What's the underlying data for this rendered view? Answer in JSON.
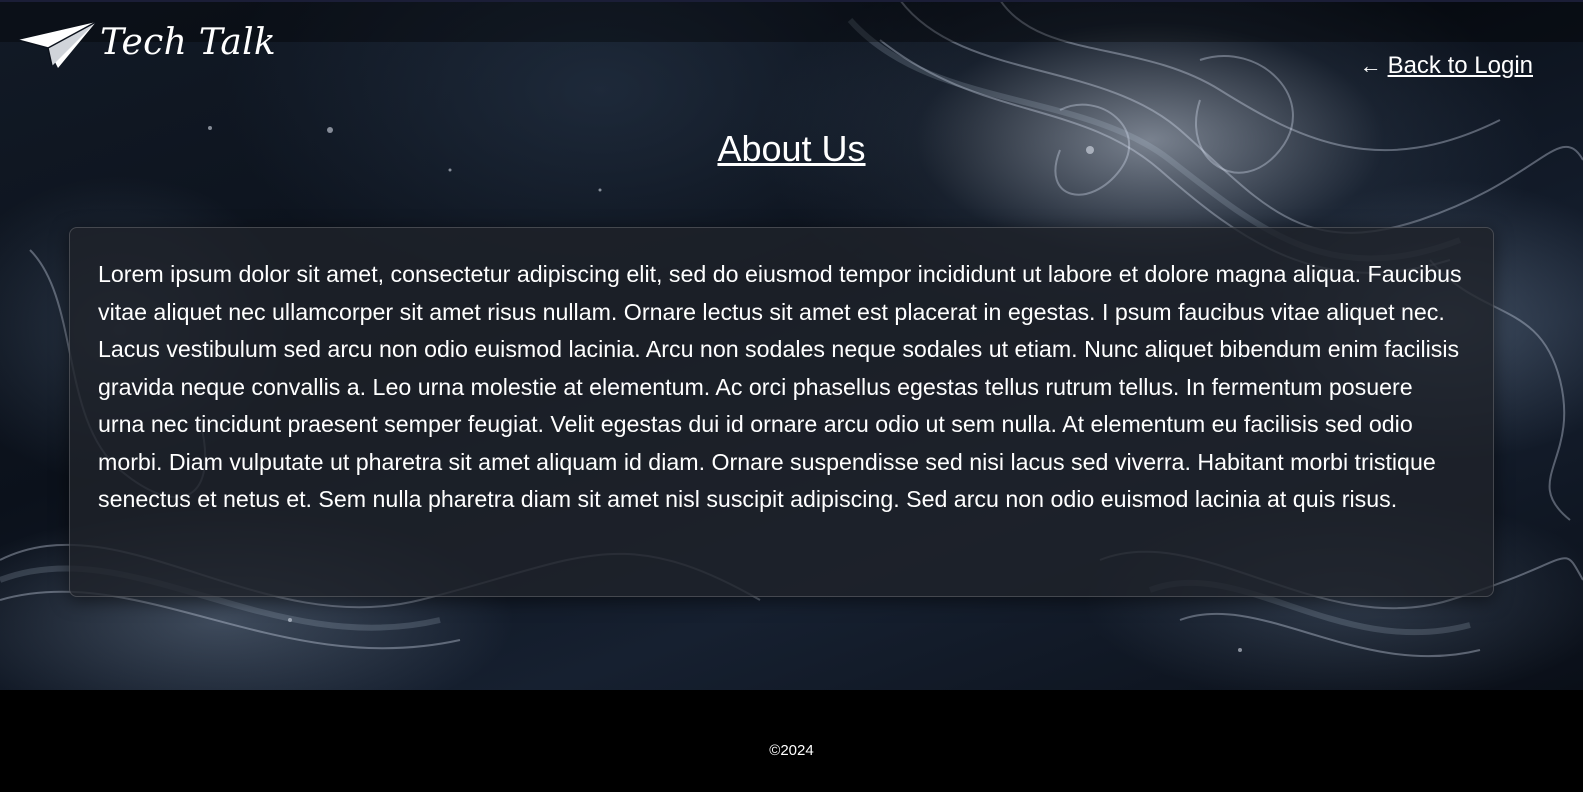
{
  "header": {
    "brand_name": "Tech Talk",
    "logo_icon": "paper-plane-icon",
    "back_link_arrow": "←",
    "back_link_label": "Back to Login"
  },
  "main": {
    "title": "About Us",
    "body": "Lorem ipsum dolor sit amet, consectetur adipiscing elit, sed do eiusmod tempor incididunt ut labore et dolore magna aliqua. Faucibus vitae aliquet nec ullamcorper sit amet risus nullam. Ornare lectus sit amet est placerat in egestas. I psum faucibus vitae aliquet nec. Lacus vestibulum sed arcu non odio euismod lacinia. Arcu non sodales neque sodales ut etiam. Nunc aliquet bibendum enim facilisis gravida neque convallis a. Leo urna molestie at elementum. Ac orci phasellus egestas tellus rutrum tellus. In fermentum posuere urna nec tincidunt praesent semper feugiat. Velit egestas dui id ornare arcu odio ut sem nulla. At elementum eu facilisis sed odio morbi. Diam vulputate ut pharetra sit amet aliquam id diam. Ornare suspendisse sed nisi lacus sed viverra. Habitant morbi tristique senectus et netus et. Sem nulla pharetra diam sit amet nisl suscipit adipiscing. Sed arcu non odio euismod lacinia at quis risus."
  },
  "footer": {
    "copyright": "©2024"
  },
  "colors": {
    "background_dark": "#0b111b",
    "footer": "#000000",
    "text": "#ffffff",
    "card_background": "#1e222a"
  }
}
